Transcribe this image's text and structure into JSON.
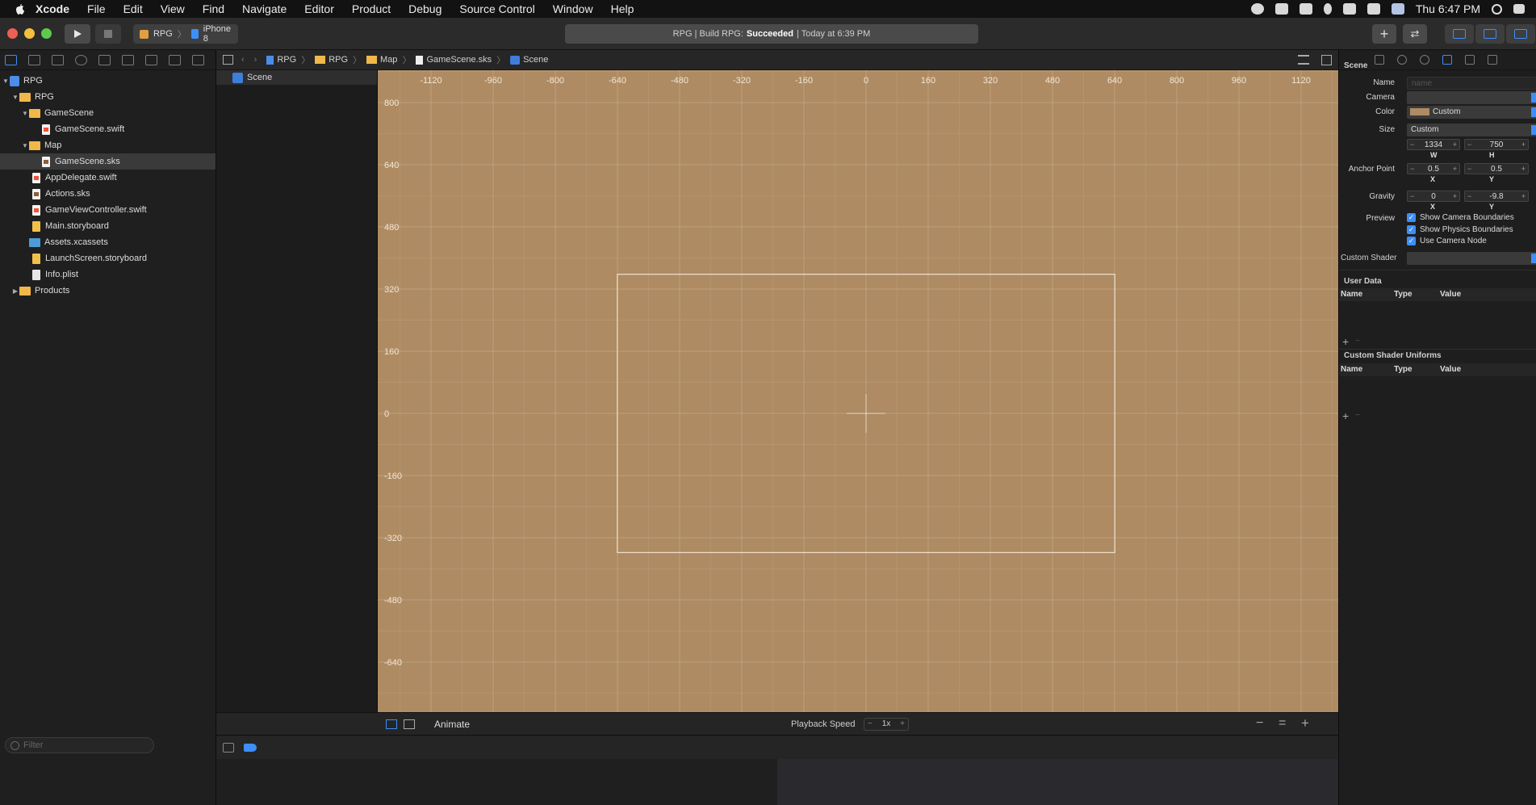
{
  "menubar": {
    "app": "Xcode",
    "items": [
      "File",
      "Edit",
      "View",
      "Find",
      "Navigate",
      "Editor",
      "Product",
      "Debug",
      "Source Control",
      "Window",
      "Help"
    ],
    "clock": "Thu 6:47 PM"
  },
  "toolbar": {
    "scheme": "RPG",
    "device": "iPhone 8",
    "status_prefix": "RPG | Build RPG:",
    "status_result": "Succeeded",
    "status_suffix": "| Today at 6:39 PM"
  },
  "navigator": {
    "tree": [
      {
        "label": "RPG",
        "kind": "project",
        "depth": 0,
        "expanded": true
      },
      {
        "label": "RPG",
        "kind": "folder",
        "depth": 1,
        "expanded": true
      },
      {
        "label": "GameScene",
        "kind": "folder",
        "depth": 2,
        "expanded": true
      },
      {
        "label": "GameScene.swift",
        "kind": "swift",
        "depth": 3
      },
      {
        "label": "Map",
        "kind": "folder",
        "depth": 2,
        "expanded": true
      },
      {
        "label": "GameScene.sks",
        "kind": "sks",
        "depth": 3,
        "selected": true
      },
      {
        "label": "AppDelegate.swift",
        "kind": "swift",
        "depth": 2
      },
      {
        "label": "Actions.sks",
        "kind": "sks",
        "depth": 2
      },
      {
        "label": "GameViewController.swift",
        "kind": "swift",
        "depth": 2
      },
      {
        "label": "Main.storyboard",
        "kind": "storyboard",
        "depth": 2
      },
      {
        "label": "Assets.xcassets",
        "kind": "assets",
        "depth": 2
      },
      {
        "label": "LaunchScreen.storyboard",
        "kind": "storyboard",
        "depth": 2
      },
      {
        "label": "Info.plist",
        "kind": "plist",
        "depth": 2
      },
      {
        "label": "Products",
        "kind": "folder",
        "depth": 1,
        "expanded": false
      }
    ],
    "filter_placeholder": "Filter"
  },
  "outline": {
    "scene_label": "Scene"
  },
  "jumpbar": {
    "crumbs": [
      "RPG",
      "RPG",
      "Map",
      "GameScene.sks",
      "Scene"
    ]
  },
  "canvas": {
    "background": "#ae8b62",
    "x_ticks": [
      "-1120",
      "-960",
      "-800",
      "-640",
      "-480",
      "-320",
      "-160",
      "0",
      "160",
      "320",
      "480",
      "640",
      "800",
      "960",
      "1120"
    ],
    "y_ticks": [
      "800",
      "640",
      "480",
      "320",
      "160",
      "0",
      "-160",
      "-320",
      "-480",
      "-640"
    ]
  },
  "editor_bottom": {
    "animate": "Animate",
    "playback_label": "Playback Speed",
    "playback_value": "1x"
  },
  "inspector": {
    "section": "Scene",
    "name_label": "Name",
    "name_placeholder": "name",
    "camera_label": "Camera",
    "color_label": "Color",
    "color_value": "Custom",
    "size_label": "Size",
    "size_value": "Custom",
    "width": "1334",
    "height": "750",
    "w_label": "W",
    "h_label": "H",
    "anchor_label": "Anchor Point",
    "anchor_x": "0.5",
    "anchor_y": "0.5",
    "x_label": "X",
    "y_label": "Y",
    "gravity_label": "Gravity",
    "gravity_x": "0",
    "gravity_y": "-9.8",
    "preview_label": "Preview",
    "checks": [
      "Show Camera Boundaries",
      "Show Physics Boundaries",
      "Use Camera Node"
    ],
    "shader_label": "Custom Shader",
    "user_data": "User Data",
    "shader_uniforms": "Custom Shader Uniforms",
    "col_name": "Name",
    "col_type": "Type",
    "col_value": "Value"
  }
}
